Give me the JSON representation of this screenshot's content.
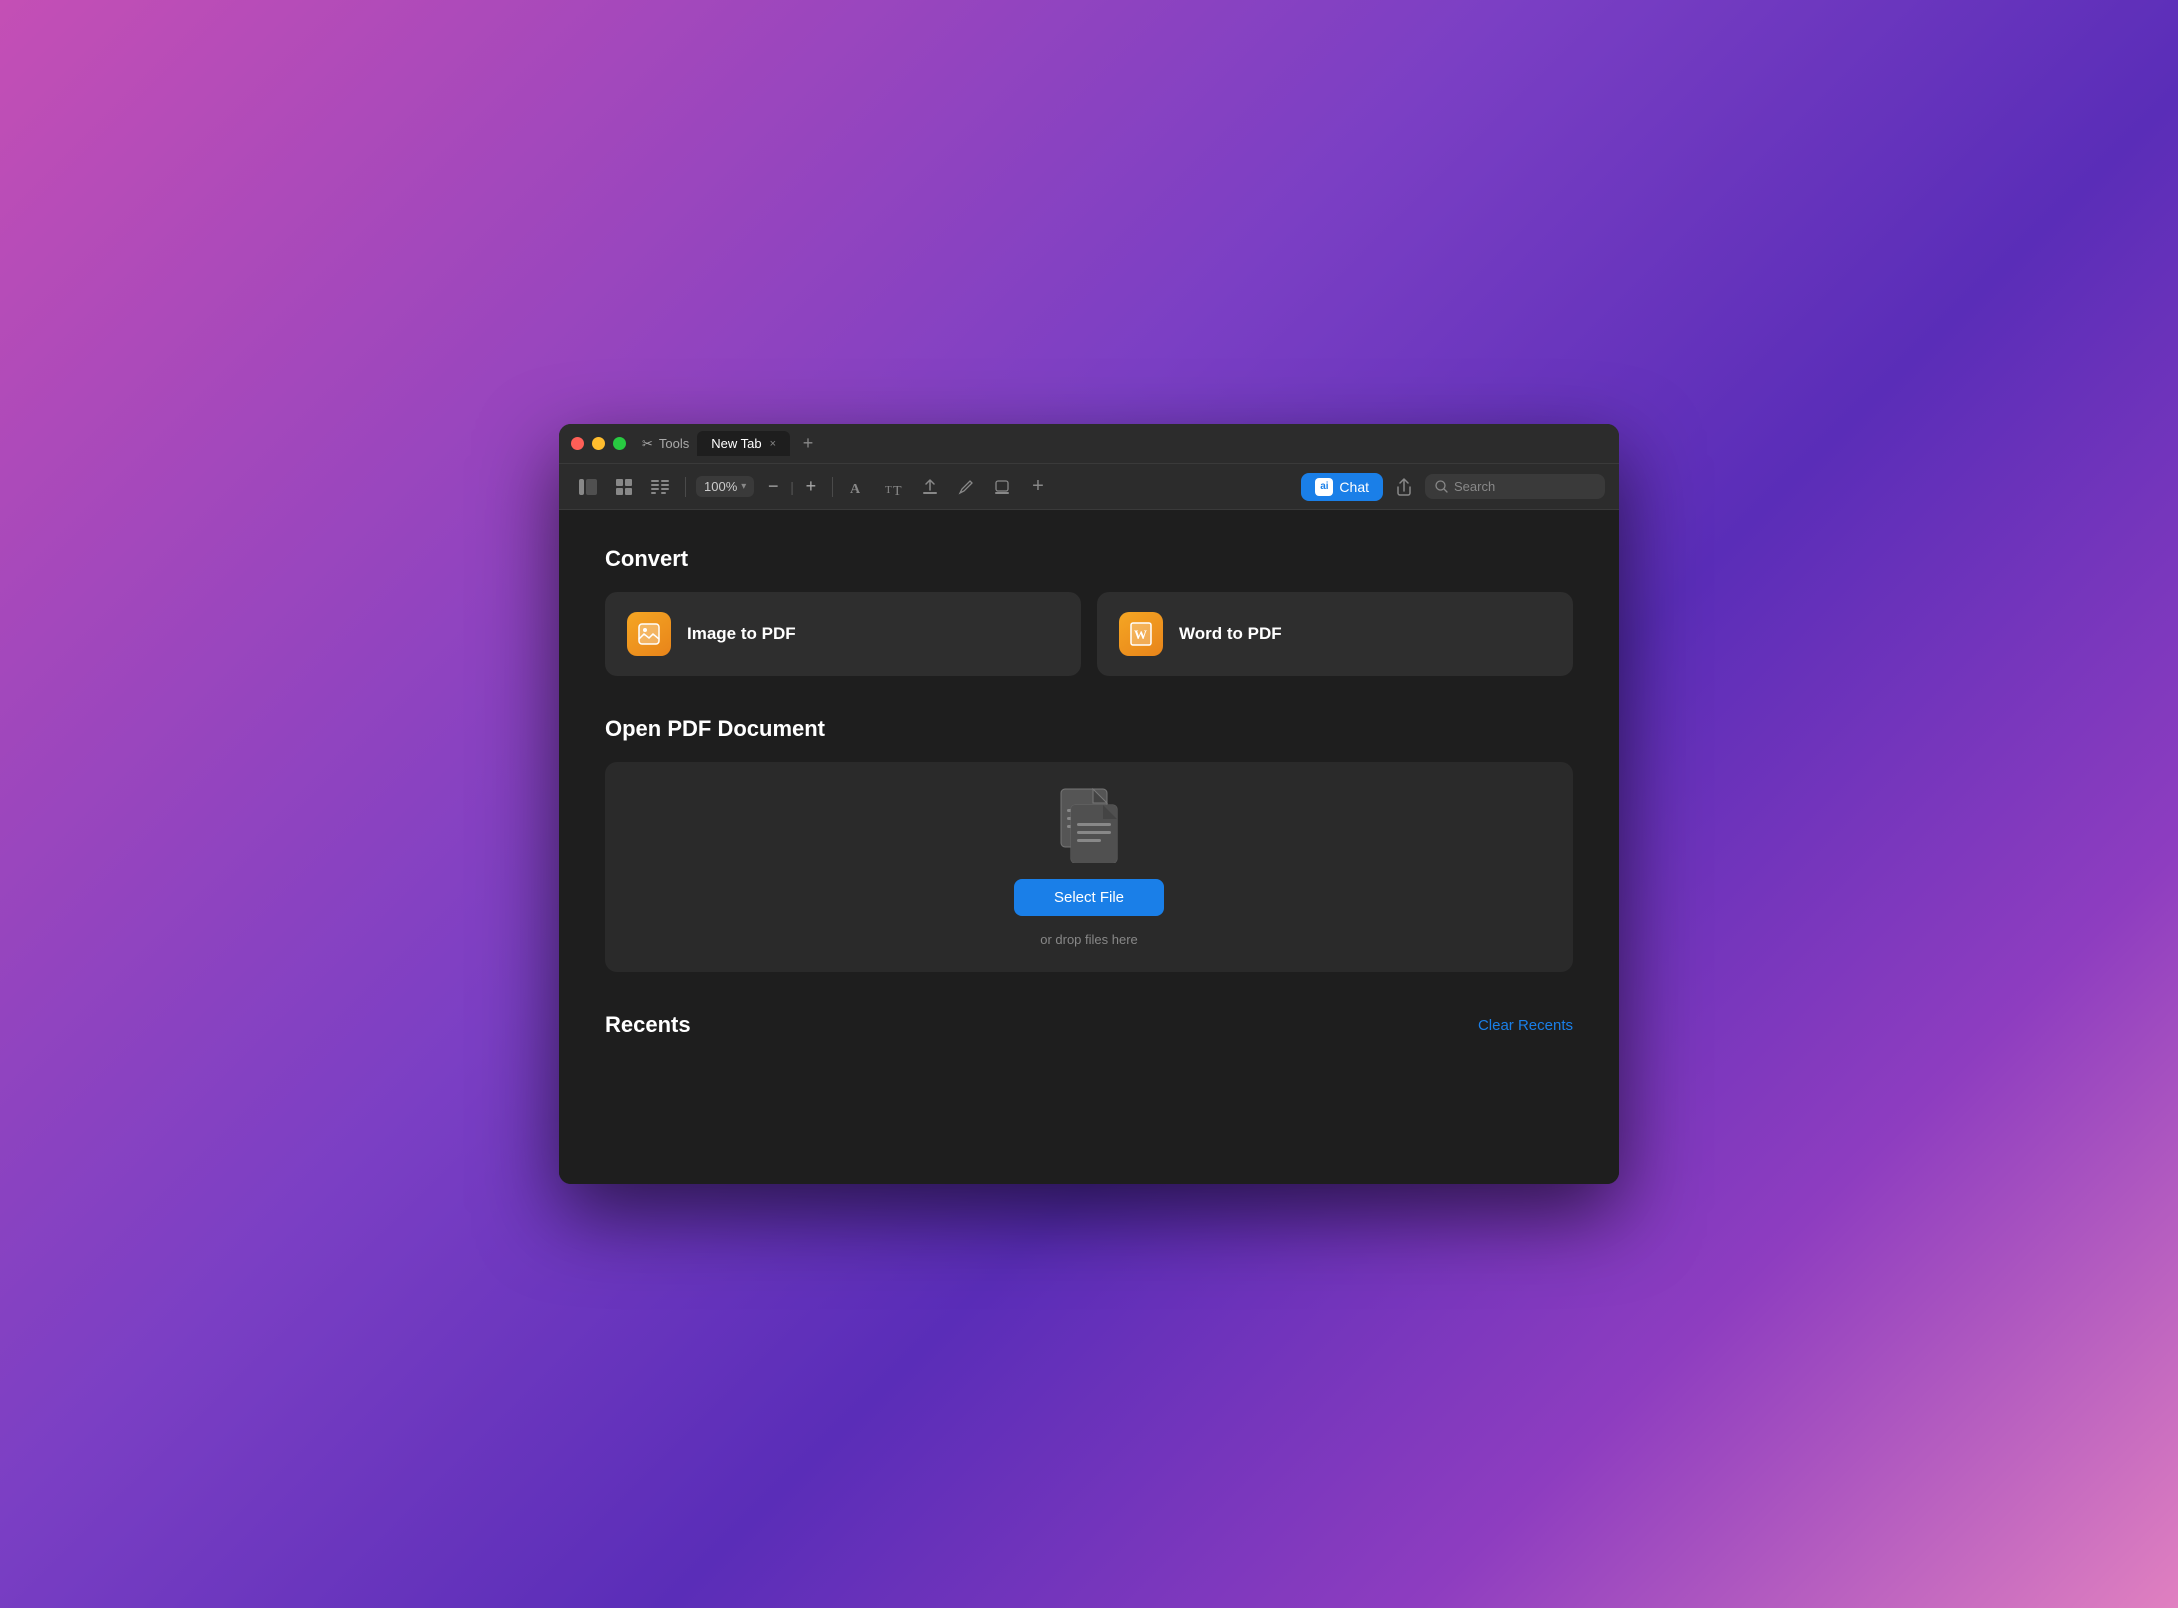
{
  "window": {
    "titlebar": {
      "tools_label": "Tools",
      "tab_name": "New Tab",
      "tab_close": "×",
      "tab_add": "+"
    },
    "toolbar": {
      "zoom_level": "100%",
      "zoom_minus": "−",
      "zoom_divider": "|",
      "zoom_plus": "+",
      "chat_label": "Chat",
      "ai_icon_label": "ai",
      "search_placeholder": "Search"
    },
    "main": {
      "convert_title": "Convert",
      "convert_cards": [
        {
          "id": "image-to-pdf",
          "label": "Image to PDF",
          "icon_type": "image"
        },
        {
          "id": "word-to-pdf",
          "label": "Word to PDF",
          "icon_type": "word"
        }
      ],
      "open_pdf_title": "Open PDF Document",
      "select_file_label": "Select File",
      "drop_hint": "or drop files here",
      "recents_title": "Recents",
      "clear_recents_label": "Clear Recents"
    }
  }
}
